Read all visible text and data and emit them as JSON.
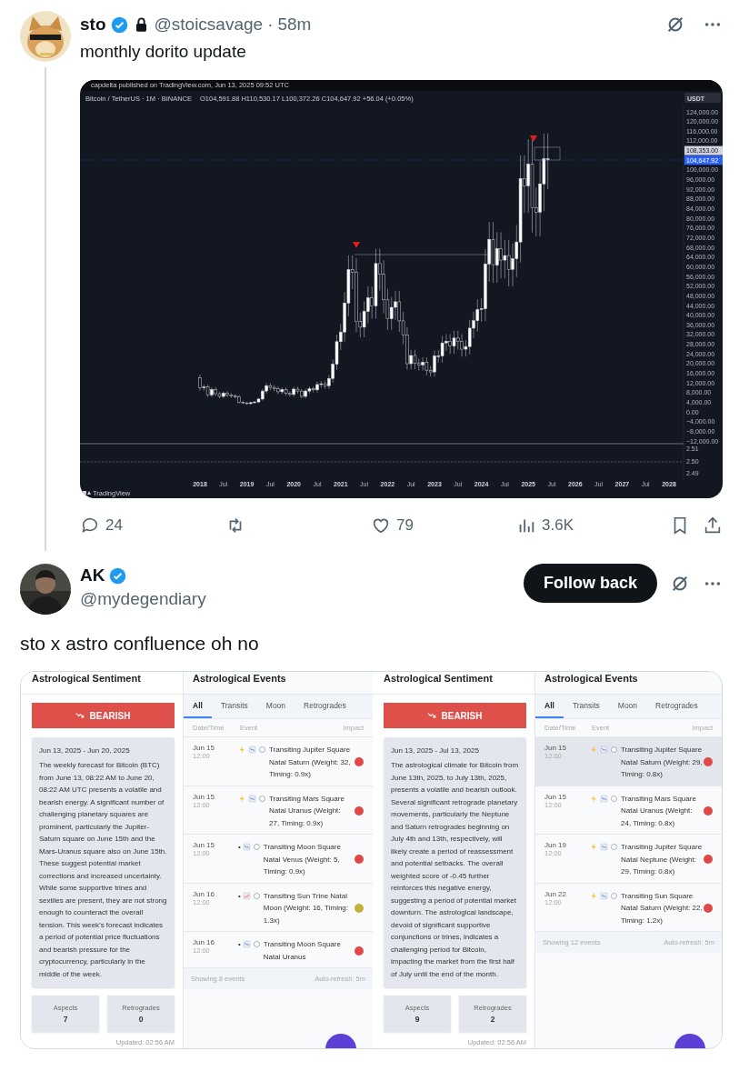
{
  "post": {
    "name": "sto",
    "verified": true,
    "locked": true,
    "handle": "@stoicsavage",
    "separator": "·",
    "time": "58m",
    "text": "monthly dorito update",
    "chart": {
      "published": "capdelta published on TradingView.com, Jun 13, 2025 09:52 UTC",
      "symbol": "Bitcoin / TetherUS · 1M · BINANCE",
      "ohlc": "O104,591.88 H110,530.17 L100,372.26 C104,647.92 +56.04 (+0.05%)",
      "currency": "USDT",
      "price_axis": [
        {
          "label": "124,000.00",
          "kind": "tick"
        },
        {
          "label": "120,000.00",
          "kind": "tick"
        },
        {
          "label": "116,000.00",
          "kind": "tick"
        },
        {
          "label": "112,000.00",
          "kind": "tick"
        },
        {
          "label": "108,353.00",
          "kind": "high"
        },
        {
          "label": "104,647.92",
          "kind": "last"
        },
        {
          "label": "100,000.00",
          "kind": "tick"
        },
        {
          "label": "96,000.00",
          "kind": "tick"
        },
        {
          "label": "92,000.00",
          "kind": "tick"
        },
        {
          "label": "88,000.00",
          "kind": "tick"
        },
        {
          "label": "84,000.00",
          "kind": "tick"
        },
        {
          "label": "80,000.00",
          "kind": "tick"
        },
        {
          "label": "76,000.00",
          "kind": "tick"
        },
        {
          "label": "72,000.00",
          "kind": "tick"
        },
        {
          "label": "68,000.00",
          "kind": "tick"
        },
        {
          "label": "64,000.00",
          "kind": "tick"
        },
        {
          "label": "60,000.00",
          "kind": "tick"
        },
        {
          "label": "56,000.00",
          "kind": "tick"
        },
        {
          "label": "52,000.00",
          "kind": "tick"
        },
        {
          "label": "48,000.00",
          "kind": "tick"
        },
        {
          "label": "44,000.00",
          "kind": "tick"
        },
        {
          "label": "40,000.00",
          "kind": "tick"
        },
        {
          "label": "36,000.00",
          "kind": "tick"
        },
        {
          "label": "32,000.00",
          "kind": "tick"
        },
        {
          "label": "28,000.00",
          "kind": "tick"
        },
        {
          "label": "24,000.00",
          "kind": "tick"
        },
        {
          "label": "20,000.00",
          "kind": "tick"
        },
        {
          "label": "16,000.00",
          "kind": "tick"
        },
        {
          "label": "12,000.00",
          "kind": "tick"
        },
        {
          "label": "8,000.00",
          "kind": "tick"
        },
        {
          "label": "4,000.00",
          "kind": "tick"
        },
        {
          "label": "0.00",
          "kind": "tick"
        },
        {
          "label": "−4,000.00",
          "kind": "tick"
        },
        {
          "label": "−8,000.00",
          "kind": "tick"
        },
        {
          "label": "−12,000.00",
          "kind": "tick"
        }
      ],
      "indicator_axis": [
        "2.51",
        "2.50",
        "2.49"
      ],
      "time_axis": [
        "2018",
        "Jul",
        "2019",
        "Jul",
        "2020",
        "Jul",
        "2021",
        "Jul",
        "2022",
        "Jul",
        "2023",
        "Jul",
        "2024",
        "Jul",
        "2025",
        "Jul",
        "2026",
        "Jul",
        "2027",
        "Jul",
        "2028"
      ],
      "brand": "TradingView"
    },
    "actions": [
      {
        "kind": "reply",
        "count": "24"
      },
      {
        "kind": "repost"
      },
      {
        "kind": "like",
        "count": "79"
      },
      {
        "kind": "views",
        "count": "3.6K"
      },
      {
        "kind": "bookmark"
      },
      {
        "kind": "share"
      }
    ]
  },
  "reply": {
    "name": "AK",
    "verified": true,
    "handle": "@mydegendiary",
    "follow_button": "Follow back",
    "text": "sto x astro confluence oh no",
    "screenshots": [
      {
        "sentiment_title": "Astrological Sentiment",
        "signal": {
          "label": "BEARISH",
          "kind": "bearish"
        },
        "period": "Jun 13, 2025 - Jun 20, 2025",
        "forecast": "The weekly forecast for Bitcoin (BTC) from June 13, 08:22 AM to June 20, 08:22 AM UTC presents a volatile and bearish energy. A significant number of challenging planetary squares are prominent, particularly the Jupiter-Saturn square on June 15th and the Mars-Uranus square also on June 15th. These suggest potential market corrections and increased uncertainty. While some supportive trines and sextiles are present, they are not strong enough to counteract the overall tension. This week's forecast indicates a period of potential price fluctuations and bearish pressure for the cryptocurrency, particularly in the middle of the week.",
        "stats": [
          {
            "label": "Aspects",
            "value": "7"
          },
          {
            "label": "Retrogrades",
            "value": "0"
          }
        ],
        "updated": "Updated: 02:56 AM",
        "events_title": "Astrological Events",
        "tabs": [
          {
            "label": "All",
            "selected": true
          },
          {
            "label": "Transits",
            "selected": false
          },
          {
            "label": "Moon",
            "selected": false
          },
          {
            "label": "Retrogrades",
            "selected": false
          }
        ],
        "columns": [
          "Date/Time",
          "Event",
          "Impact"
        ],
        "events": [
          {
            "date": "Jun 15",
            "time": "12:00",
            "kind": "major",
            "text": "Transiting Jupiter Square Natal Saturn (Weight: 32, Timing: 0.9x)",
            "color": "#e04848",
            "selected": false
          },
          {
            "date": "Jun 15",
            "time": "12:00",
            "kind": "major",
            "text": "Transiting Mars Square Natal Uranus (Weight: 27, Timing: 0.9x)",
            "color": "#e04848",
            "selected": false
          },
          {
            "date": "Jun 15",
            "time": "12:00",
            "kind": "minor",
            "bullet": "•",
            "text": "Transiting Moon Square Natal Venus (Weight: 5, Timing: 0.9x)",
            "color": "#e04848",
            "selected": false
          },
          {
            "date": "Jun 16",
            "time": "12:00",
            "kind": "supportive",
            "bullet": "•",
            "text": "Transiting Sun Trine Natal Moon (Weight: 16, Timing: 1.3x)",
            "color": "#c4b13c",
            "selected": false
          },
          {
            "date": "Jun 16",
            "time": "12:00",
            "kind": "minor",
            "bullet": "•",
            "text": "Transiting Moon Square Natal Uranus",
            "color": "#e04848",
            "selected": false
          }
        ],
        "showing": "Showing 8 events",
        "refresh": "Auto-refresh: 5m"
      },
      {
        "sentiment_title": "Astrological Sentiment",
        "signal": {
          "label": "BEARISH",
          "kind": "bearish"
        },
        "period": "Jun 13, 2025 - Jul 13, 2025",
        "forecast": "The astrological climate for Bitcoin from June 13th, 2025, to July 13th, 2025, presents a volatile and bearish outlook. Several significant retrograde planetary movements, particularly the Neptune and Saturn retrogrades beginning on July 4th and 13th, respectively, will likely create a period of reassessment and potential setbacks. The overall weighted score of -0.45 further reinforces this negative energy, suggesting a period of potential market downturn. The astrological landscape, devoid of significant supportive conjunctions or trines, indicates a challenging period for Bitcoin, impacting the market from the first half of July until the end of the month.",
        "stats": [
          {
            "label": "Aspects",
            "value": "9"
          },
          {
            "label": "Retrogrades",
            "value": "2"
          }
        ],
        "updated": "Updated: 02:56 AM",
        "events_title": "Astrological Events",
        "tabs": [
          {
            "label": "All",
            "selected": true
          },
          {
            "label": "Transits",
            "selected": false
          },
          {
            "label": "Moon",
            "selected": false
          },
          {
            "label": "Retrogrades",
            "selected": false
          }
        ],
        "columns": [
          "Date/Time",
          "Event",
          "Impact"
        ],
        "events": [
          {
            "date": "Jun 15",
            "time": "12:00",
            "kind": "major",
            "text": "Transiting Jupiter Square Natal Saturn (Weight: 29, Timing: 0.8x)",
            "color": "#e04848",
            "selected": true
          },
          {
            "date": "Jun 15",
            "time": "12:00",
            "kind": "major",
            "text": "Transiting Mars Square Natal Uranus (Weight: 24, Timing: 0.8x)",
            "color": "#e04848",
            "selected": false
          },
          {
            "date": "Jun 19",
            "time": "12:00",
            "kind": "major",
            "text": "Transiting Jupiter Square Natal Neptune (Weight: 29, Timing: 0.8x)",
            "color": "#e04848",
            "selected": false
          },
          {
            "date": "Jun 22",
            "time": "12:00",
            "kind": "major",
            "text": "Transiting Sun Square Natal Saturn (Weight: 22, Timing: 1.2x)",
            "color": "#e04848",
            "selected": false
          }
        ],
        "showing": "Showing 12 events",
        "refresh": "Auto-refresh: 5m"
      }
    ]
  }
}
